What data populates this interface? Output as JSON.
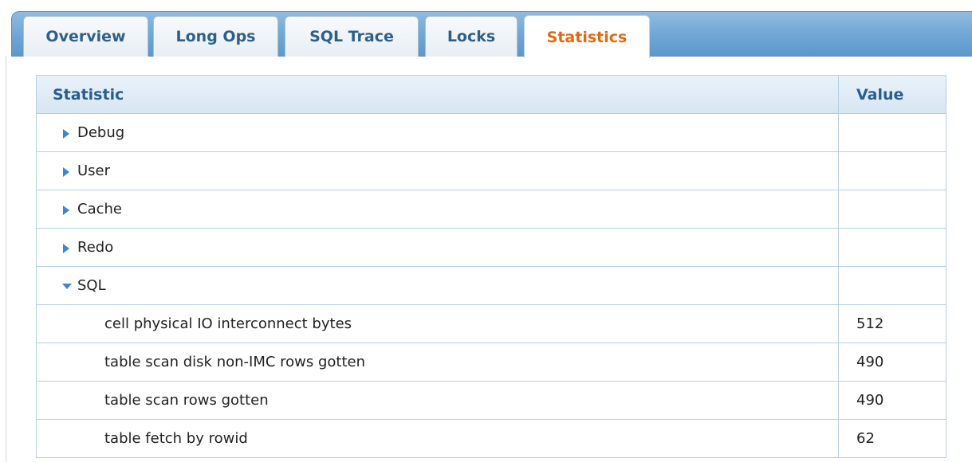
{
  "tabs": [
    {
      "label": "Overview",
      "active": false
    },
    {
      "label": "Long Ops",
      "active": false
    },
    {
      "label": "SQL Trace",
      "active": false
    },
    {
      "label": "Locks",
      "active": false
    },
    {
      "label": "Statistics",
      "active": true
    }
  ],
  "table": {
    "headers": {
      "statistic": "Statistic",
      "value": "Value"
    },
    "groups": [
      {
        "label": "Debug",
        "expanded": false,
        "icon": "triangle-right-icon"
      },
      {
        "label": "User",
        "expanded": false,
        "icon": "triangle-right-icon"
      },
      {
        "label": "Cache",
        "expanded": false,
        "icon": "triangle-right-icon"
      },
      {
        "label": "Redo",
        "expanded": false,
        "icon": "triangle-right-icon"
      },
      {
        "label": "SQL",
        "expanded": true,
        "icon": "triangle-down-icon"
      }
    ],
    "sql_rows": [
      {
        "name": "cell physical IO interconnect bytes",
        "value": "512"
      },
      {
        "name": "table scan disk non-IMC rows gotten",
        "value": "490"
      },
      {
        "name": "table scan rows gotten",
        "value": "490"
      },
      {
        "name": "table fetch by rowid",
        "value": "62"
      }
    ]
  },
  "colors": {
    "tab_text": "#2d5f8a",
    "active_tab_text": "#e06a14",
    "header_text": "#2a5d8c",
    "expander": "#3b86cc"
  }
}
